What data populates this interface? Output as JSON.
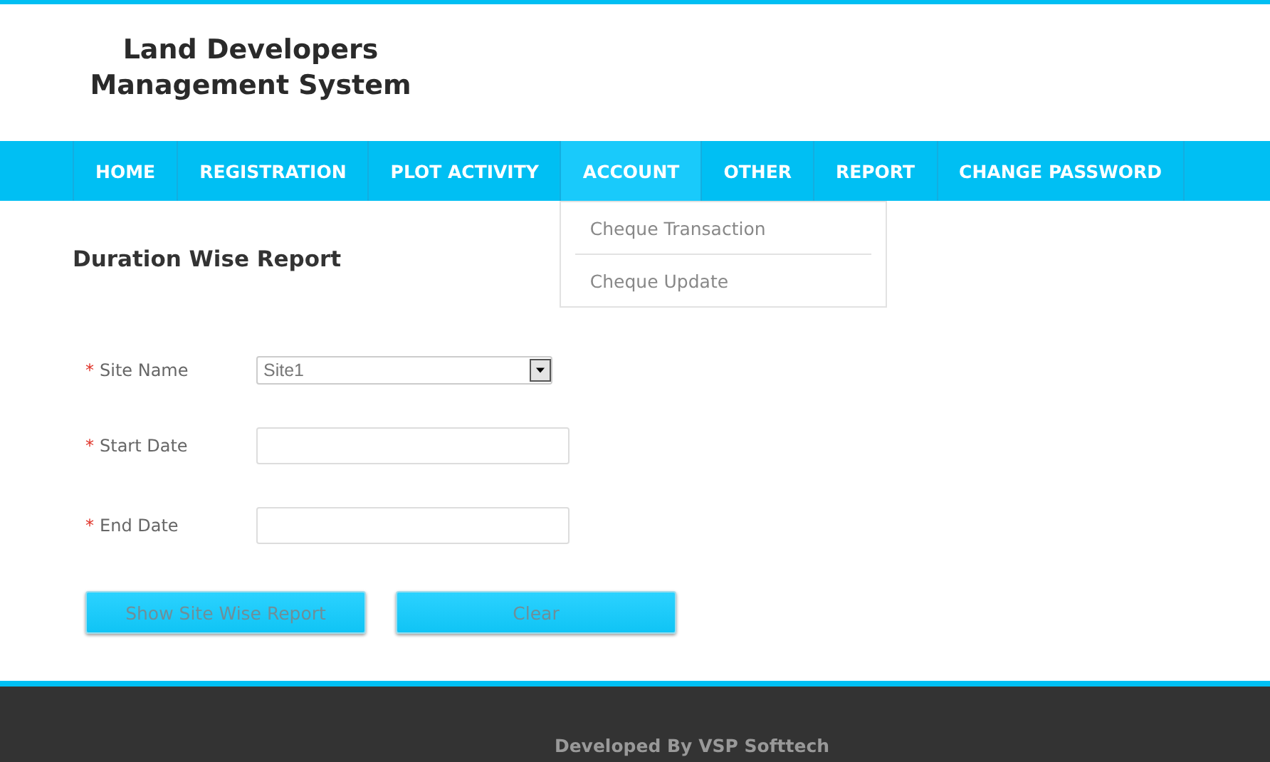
{
  "header": {
    "title_lines": [
      "Land Developers",
      "Management System"
    ]
  },
  "nav": [
    {
      "label": "HOME",
      "selected": false
    },
    {
      "label": "REGISTRATION",
      "selected": false
    },
    {
      "label": "PLOT ACTIVITY",
      "selected": false
    },
    {
      "label": "ACCOUNT",
      "selected": true,
      "expanded": true,
      "menu": [
        "Cheque Transaction",
        "Cheque Update"
      ]
    },
    {
      "label": "OTHER",
      "selected": false
    },
    {
      "label": "REPORT",
      "selected": false
    },
    {
      "label": "CHANGE PASSWORD",
      "selected": false
    }
  ],
  "page_title": "Duration Wise Report",
  "form": [
    {
      "kind": "select",
      "required_mark": "*",
      "label": "Site Name",
      "value": "Site1"
    },
    {
      "kind": "text",
      "required_mark": "*",
      "label": "Start Date"
    },
    {
      "kind": "text",
      "required_mark": "*",
      "label": "End Date"
    }
  ],
  "buttons": [
    "Show Site Wise Report",
    "Clear"
  ],
  "footer": {
    "prefix": "Developed By ",
    "company": "VSP Softtech"
  }
}
